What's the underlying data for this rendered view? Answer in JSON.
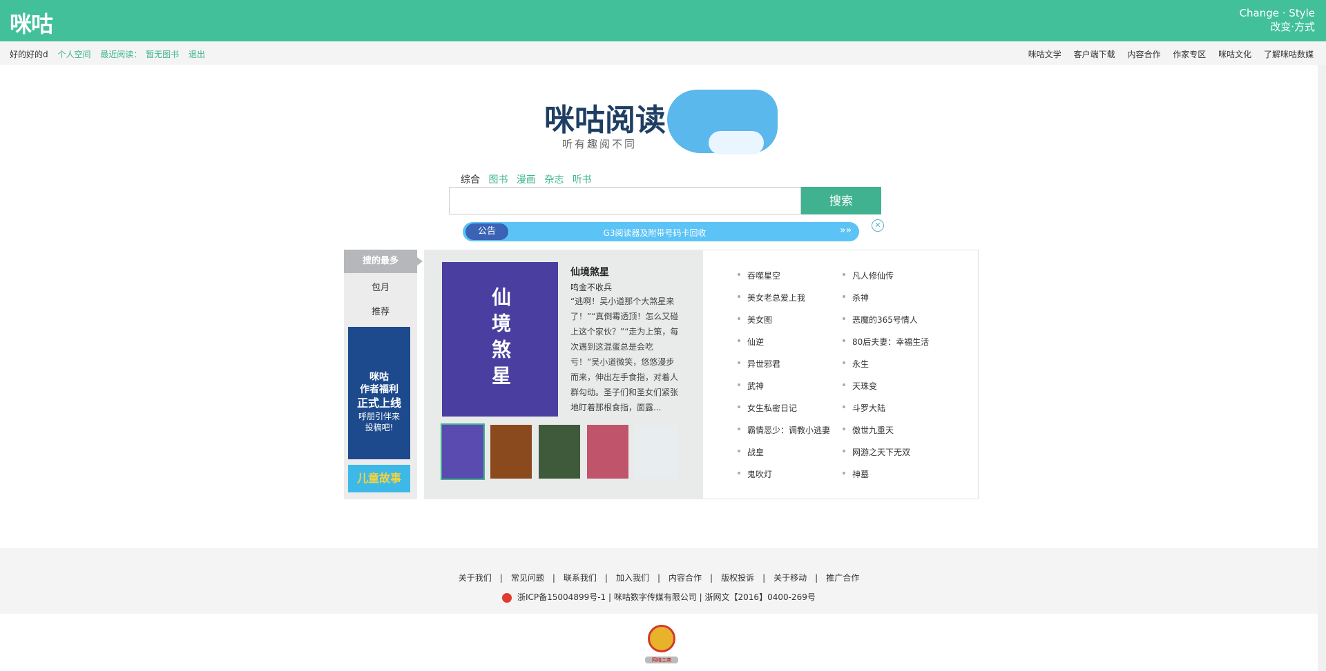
{
  "topbar": {
    "logo": "咪咕",
    "change_style_en": "Change · Style",
    "change_style_cn": "改变·方式"
  },
  "subbar": {
    "user": "好的好的d",
    "personal_space": "个人空间",
    "recent_read": "最近阅读：",
    "no_books": "暂无图书",
    "logout": "退出",
    "links": [
      "咪咕文学",
      "客户端下载",
      "内容合作",
      "作家专区",
      "咪咕文化",
      "了解咪咕数媒"
    ]
  },
  "brand": {
    "mark": "咪咕阅读",
    "slogan": "听有趣阅不同"
  },
  "search": {
    "tabs": [
      "综合",
      "图书",
      "漫画",
      "杂志",
      "听书"
    ],
    "active_tab": "综合",
    "value": "",
    "button": "搜索"
  },
  "notice": {
    "tag": "公告",
    "text": "G3阅读器及附带号码卡回收",
    "arrows": "»»",
    "close": "✕"
  },
  "side": {
    "hot": "搜的最多",
    "items": [
      "包月",
      "推荐"
    ],
    "ad1": {
      "t1": "咪咕",
      "t2": "作者福利",
      "t3": "正式上线",
      "t4": "呼朋引伴来",
      "t5": "投稿吧!"
    },
    "ad2": "儿童故事"
  },
  "feature": {
    "cover_text": "仙境煞星",
    "title": "仙境煞星",
    "author": "鸣金不收兵",
    "desc": "“逃啊！吴小道那个大煞星来了！”“真倒霉透顶！怎么又碰上这个家伙？”“走为上策，每次遇到这混蛋总是会吃亏！”吴小道微笑，悠悠漫步而来，伸出左手食指，对着人群勾动。圣子们和圣女们紧张地盯着那根食指，面露..."
  },
  "thumb_colors": [
    "#5a4bb0",
    "#8a4a1e",
    "#3f5a3a",
    "#c0546a",
    "#e8eef0"
  ],
  "hot_list": {
    "col1": [
      "吞噬星空",
      "美女老总爱上我",
      "美女图",
      "仙逆",
      "异世邪君",
      "武神",
      "女生私密日记",
      "霸情恶少：调教小逃妻",
      "战皇",
      "鬼吹灯"
    ],
    "col2": [
      "凡人修仙传",
      "杀神",
      "恶魔的365号情人",
      "80后夫妻：幸福生活",
      "永生",
      "天珠变",
      "斗罗大陆",
      "傲世九重天",
      "网游之天下无双",
      "神墓"
    ]
  },
  "footer": {
    "links": [
      "关于我们",
      "常见问题",
      "联系我们",
      "加入我们",
      "内容合作",
      "版权投诉",
      "关于移动",
      "推广合作"
    ],
    "icp": "浙ICP备15004899号-1 | 咪咕数字传媒有限公司 | 浙网文【2016】0400-269号",
    "emblem_label": "网络工商"
  }
}
